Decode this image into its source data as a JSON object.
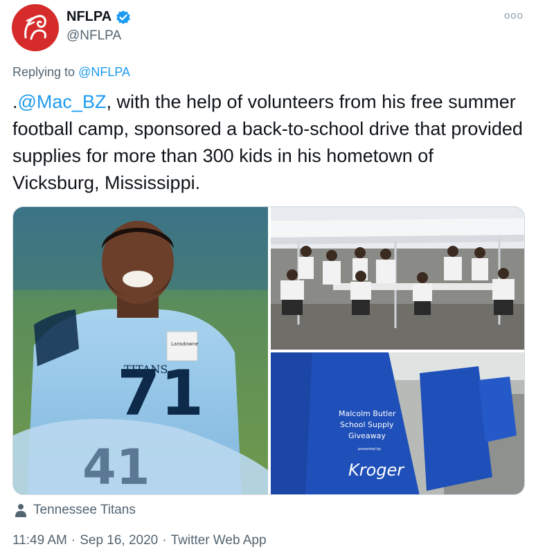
{
  "account": {
    "display_name": "NFLPA",
    "handle": "@NFLPA",
    "avatar_icon": "nflpa-logo",
    "verified_icon": "verified-badge-icon",
    "more_icon": "more-options-icon",
    "more_label": "ooo"
  },
  "reply": {
    "prefix": "Replying to ",
    "to_handle": "@NFLPA"
  },
  "tweet": {
    "mention": "@Mac_BZ",
    "leading_dot": ".",
    "text_after_mention": ", with the help of volunteers from his free summer football camp, sponsored a back-to-school drive that provided supplies for more than 300 kids in his hometown of Vicksburg, Mississippi."
  },
  "media": {
    "photo1": {
      "jersey_label": "TITANS",
      "name_tag": "Lansdowne"
    },
    "photo3": {
      "bag_text_line1": "Malcolm Butler",
      "bag_text_line2": "School Supply",
      "bag_text_line3": "Giveaway",
      "bag_text_line4": "presented by",
      "bag_brand": "Kroger"
    }
  },
  "tag": {
    "icon": "person-icon",
    "label": "Tennessee Titans"
  },
  "meta": {
    "time": "11:49 AM",
    "separator1": "·",
    "date": "Sep 16, 2020",
    "separator2": "·",
    "source": "Twitter Web App"
  },
  "colors": {
    "accent": "#1d9bf0",
    "secondary_text": "#536471",
    "avatar_bg": "#d62b2b",
    "bag_blue": "#1f4fb8"
  }
}
